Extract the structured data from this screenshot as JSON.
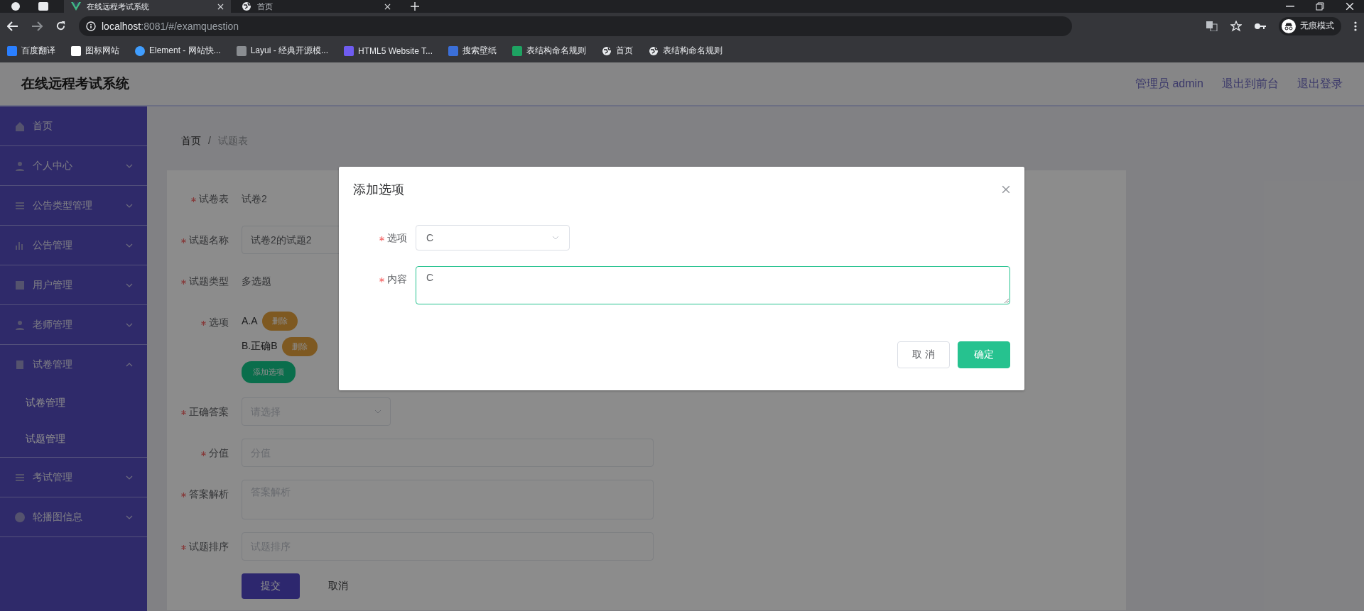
{
  "browser": {
    "tabs": [
      {
        "title": "在线远程考试系统",
        "selected": true
      },
      {
        "title": "首页",
        "selected": false
      }
    ],
    "address": {
      "host": "localhost",
      "path": ":8081/#/examquestion"
    },
    "profile": "无痕模式",
    "bookmarks": [
      "百度翻译",
      "图标网站",
      "Element - 网站快...",
      "Layui - 经典开源模...",
      "HTML5 Website T...",
      "搜索壁纸",
      "表结构命名规则",
      "首页",
      "表结构命名规则"
    ]
  },
  "header": {
    "title": "在线远程考试系统",
    "links": [
      "管理员 admin",
      "退出到前台",
      "退出登录"
    ]
  },
  "sidebar": {
    "items": [
      {
        "label": "首页",
        "kind": "link"
      },
      {
        "label": "个人中心",
        "kind": "submenu",
        "expanded": false
      },
      {
        "label": "公告类型管理",
        "kind": "submenu",
        "expanded": false
      },
      {
        "label": "公告管理",
        "kind": "submenu",
        "expanded": false
      },
      {
        "label": "用户管理",
        "kind": "submenu",
        "expanded": false
      },
      {
        "label": "老师管理",
        "kind": "submenu",
        "expanded": false
      },
      {
        "label": "试卷管理",
        "kind": "submenu",
        "expanded": true,
        "children": [
          {
            "label": "试卷管理"
          },
          {
            "label": "试题管理"
          }
        ]
      },
      {
        "label": "考试管理",
        "kind": "submenu",
        "expanded": false
      },
      {
        "label": "轮播图信息",
        "kind": "submenu",
        "expanded": false
      }
    ]
  },
  "breadcrumb": {
    "items": [
      "首页",
      "试题表"
    ],
    "separator": "/"
  },
  "form": {
    "fields": [
      {
        "label": "试卷表",
        "required": true,
        "kind": "text",
        "value": "试卷2"
      },
      {
        "label": "试题名称",
        "required": true,
        "kind": "input",
        "value": "试卷2的试题2"
      },
      {
        "label": "试题类型",
        "required": true,
        "kind": "text",
        "value": "多选题"
      },
      {
        "label": "选项",
        "required": true,
        "kind": "options",
        "options": [
          {
            "text": "A.A",
            "action": "删除"
          },
          {
            "text": "B.正确B",
            "action": "删除"
          }
        ],
        "add": "添加选项"
      },
      {
        "label": "正确答案",
        "required": true,
        "kind": "select",
        "placeholder": "请选择"
      },
      {
        "label": "分值",
        "required": true,
        "kind": "input",
        "placeholder": "分值"
      },
      {
        "label": "答案解析",
        "required": true,
        "kind": "textarea",
        "placeholder": "答案解析"
      },
      {
        "label": "试题排序",
        "required": true,
        "kind": "input",
        "placeholder": "试题排序"
      }
    ],
    "buttons": [
      {
        "label": "提交",
        "kind": "primary"
      },
      {
        "label": "取消",
        "kind": "text"
      }
    ]
  },
  "dialog": {
    "title": "添加选项",
    "fields": [
      {
        "label": "选项",
        "required": true,
        "kind": "select",
        "value": "C",
        "focused": false
      },
      {
        "label": "内容",
        "required": true,
        "kind": "textarea",
        "value": "C",
        "focused": true
      }
    ],
    "buttons": [
      {
        "label": "取 消",
        "kind": "default"
      },
      {
        "label": "确定",
        "kind": "primary"
      }
    ]
  }
}
